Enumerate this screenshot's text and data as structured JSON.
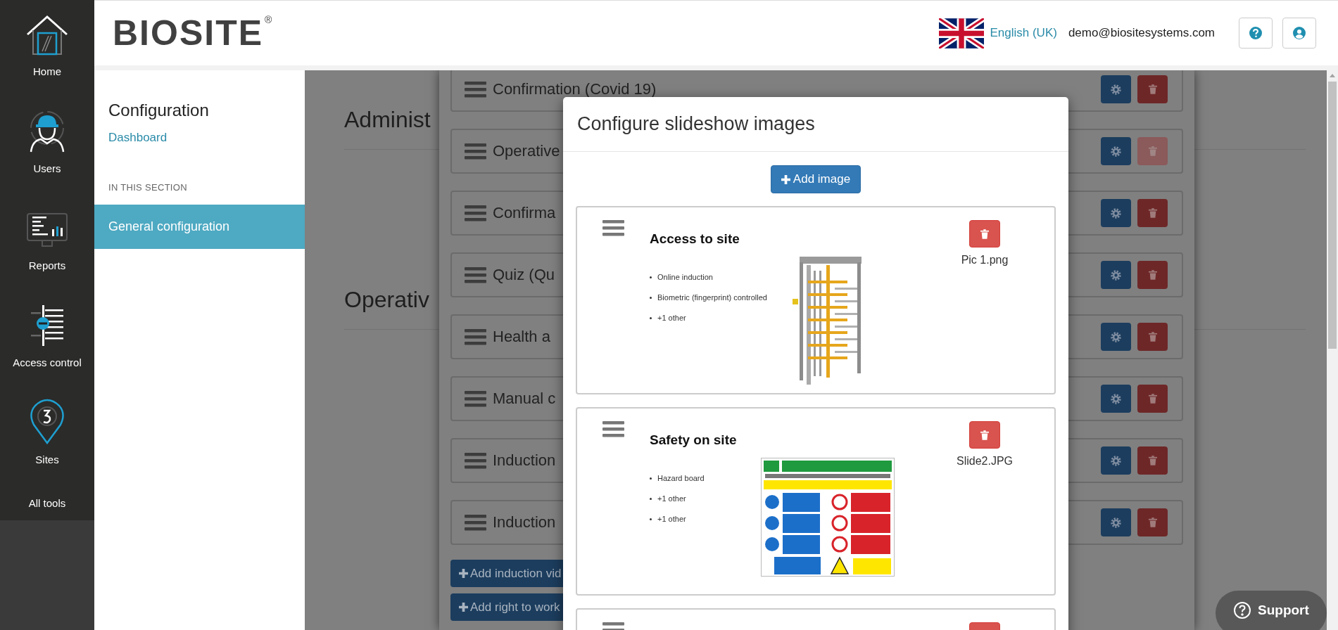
{
  "nav": {
    "items": [
      {
        "label": "Home"
      },
      {
        "label": "Users"
      },
      {
        "label": "Reports"
      },
      {
        "label": "Access control"
      },
      {
        "label": "Sites"
      }
    ],
    "all_tools": "All tools"
  },
  "header": {
    "logo": "BIOSITE",
    "logo_mark": "®",
    "language": "English (UK)",
    "user_email": "demo@biositesystems.com"
  },
  "section_nav": {
    "title": "Configuration",
    "breadcrumb": "Dashboard",
    "section_label": "IN THIS SECTION",
    "items": [
      {
        "label": "General configuration",
        "selected": true
      }
    ]
  },
  "page": {
    "headings": [
      "Administ",
      "Operativ"
    ]
  },
  "steps_panel": {
    "items": [
      {
        "label": "Confirmation (Covid 19)",
        "delete_disabled": false
      },
      {
        "label": "Operative",
        "delete_disabled": true
      },
      {
        "label": "Confirma",
        "delete_disabled": false
      },
      {
        "label": "Quiz (Qu",
        "delete_disabled": false
      },
      {
        "label": "Health a",
        "delete_disabled": false
      },
      {
        "label": "Manual c",
        "delete_disabled": false
      },
      {
        "label": "Induction",
        "delete_disabled": false
      },
      {
        "label": "Induction",
        "delete_disabled": false
      }
    ],
    "buttons": [
      "Add induction vid",
      "Add right to work"
    ]
  },
  "modal": {
    "title": "Configure slideshow images",
    "add_button": "Add image",
    "slides": [
      {
        "kind": "full",
        "title": "Access to site",
        "bullets": [
          "Online induction",
          "Biometric (fingerprint) controlled",
          "+1 other"
        ],
        "image": {
          "kind": "turnstile"
        },
        "file": "Pic 1.png"
      },
      {
        "kind": "full",
        "title": "Safety on site",
        "bullets": [
          "Hazard board",
          "+1 other",
          "+1 other"
        ],
        "image": {
          "kind": "safety-sign"
        },
        "file": "Slide2.JPG"
      },
      {
        "kind": "cut"
      }
    ]
  },
  "support_button": "Support"
}
